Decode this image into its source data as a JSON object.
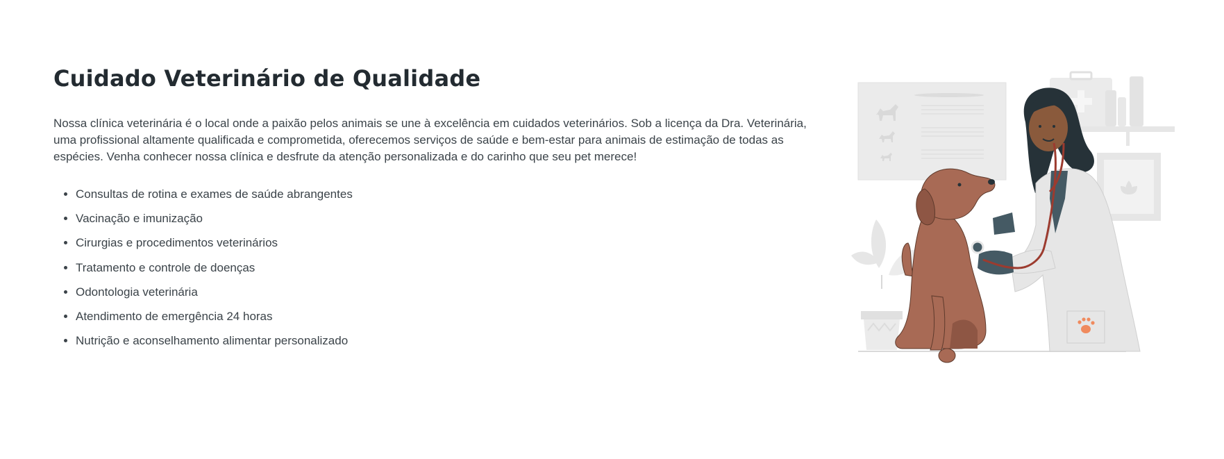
{
  "section": {
    "title": "Cuidado Veterinário de Qualidade",
    "intro": "Nossa clínica veterinária é o local onde a paixão pelos animais se une à excelência em cuidados veterinários. Sob a licença da Dra. Veterinária, uma profissional altamente qualificada e comprometida, oferecemos serviços de saúde e bem-estar para animais de estimação de todas as espécies. Venha conhecer nossa clínica e desfrute da atenção personalizada e do carinho que seu pet merece!",
    "features": [
      "Consultas de rotina e exames de saúde abrangentes",
      "Vacinação e imunização",
      "Cirurgias e procedimentos veterinários",
      "Tratamento e controle de doenças",
      "Odontologia veterinária",
      "Atendimento de emergência 24 horas",
      "Nutrição e aconselhamento alimentar personalizado"
    ]
  },
  "illustration": {
    "icon": "veterinarian-with-dog-illustration",
    "colors": {
      "skin": "#8a5a3c",
      "hair": "#263238",
      "dog": "#a86a55",
      "gloves": "#455a64",
      "stethoscope": "#9c3b2f",
      "coat": "#e6e6e6",
      "background_shapes": "#ebebeb",
      "paw_accent": "#f08a5d"
    }
  }
}
